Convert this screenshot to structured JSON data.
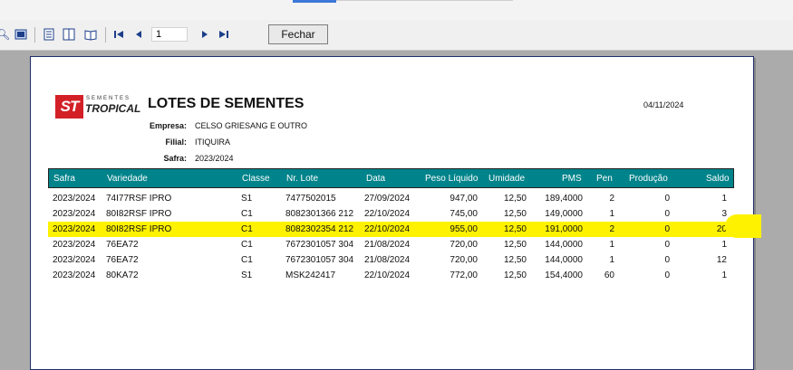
{
  "toolbar": {
    "page_number": "1",
    "close_label": "Fechar",
    "icons": [
      "zoom-icon",
      "fit-page-icon",
      "single-page-icon",
      "multi-page-icon",
      "book-icon",
      "first-page-icon",
      "prev-page-icon",
      "next-page-icon",
      "last-page-icon"
    ]
  },
  "report": {
    "brand_top": "SEMENTES",
    "brand_main": "TROPICAL",
    "logo_text": "ST",
    "title": "LOTES DE SEMENTES",
    "date": "04/11/2024",
    "empresa_label": "Empresa:",
    "empresa_value": "CELSO GRIESANG E OUTRO",
    "filial_label": "Filial:",
    "filial_value": "ITIQUIRA",
    "safra_label": "Safra:",
    "safra_value": "2023/2024"
  },
  "table": {
    "headers": [
      "Safra",
      "Variedade",
      "Classe",
      "Nr. Lote",
      "Data",
      "Peso Líquido",
      "Umidade",
      "PMS",
      "Pen",
      "Produção",
      "Saldo"
    ],
    "rows": [
      [
        "2023/2024",
        "74I77RSF IPRO",
        "S1",
        "7477502015",
        "27/09/2024",
        "947,00",
        "12,50",
        "189,4000",
        "2",
        "0",
        "1"
      ],
      [
        "2023/2024",
        "80I82RSF IPRO",
        "C1",
        "8082301366  212",
        "22/10/2024",
        "745,00",
        "12,50",
        "149,0000",
        "1",
        "0",
        "3"
      ],
      [
        "2023/2024",
        "80I82RSF IPRO",
        "C1",
        "8082302354  212",
        "22/10/2024",
        "955,00",
        "12,50",
        "191,0000",
        "2",
        "0",
        "20"
      ],
      [
        "2023/2024",
        "76EA72",
        "C1",
        "7672301057  304",
        "21/08/2024",
        "720,00",
        "12,50",
        "144,0000",
        "1",
        "0",
        "1"
      ],
      [
        "2023/2024",
        "76EA72",
        "C1",
        "7672301057  304",
        "21/08/2024",
        "720,00",
        "12,50",
        "144,0000",
        "1",
        "0",
        "12"
      ],
      [
        "2023/2024",
        "80KA72",
        "S1",
        "MSK242417",
        "22/10/2024",
        "772,00",
        "12,50",
        "154,4000",
        "60",
        "0",
        "1"
      ]
    ],
    "highlight_color": "#fff200",
    "header_color": "#00838a"
  }
}
